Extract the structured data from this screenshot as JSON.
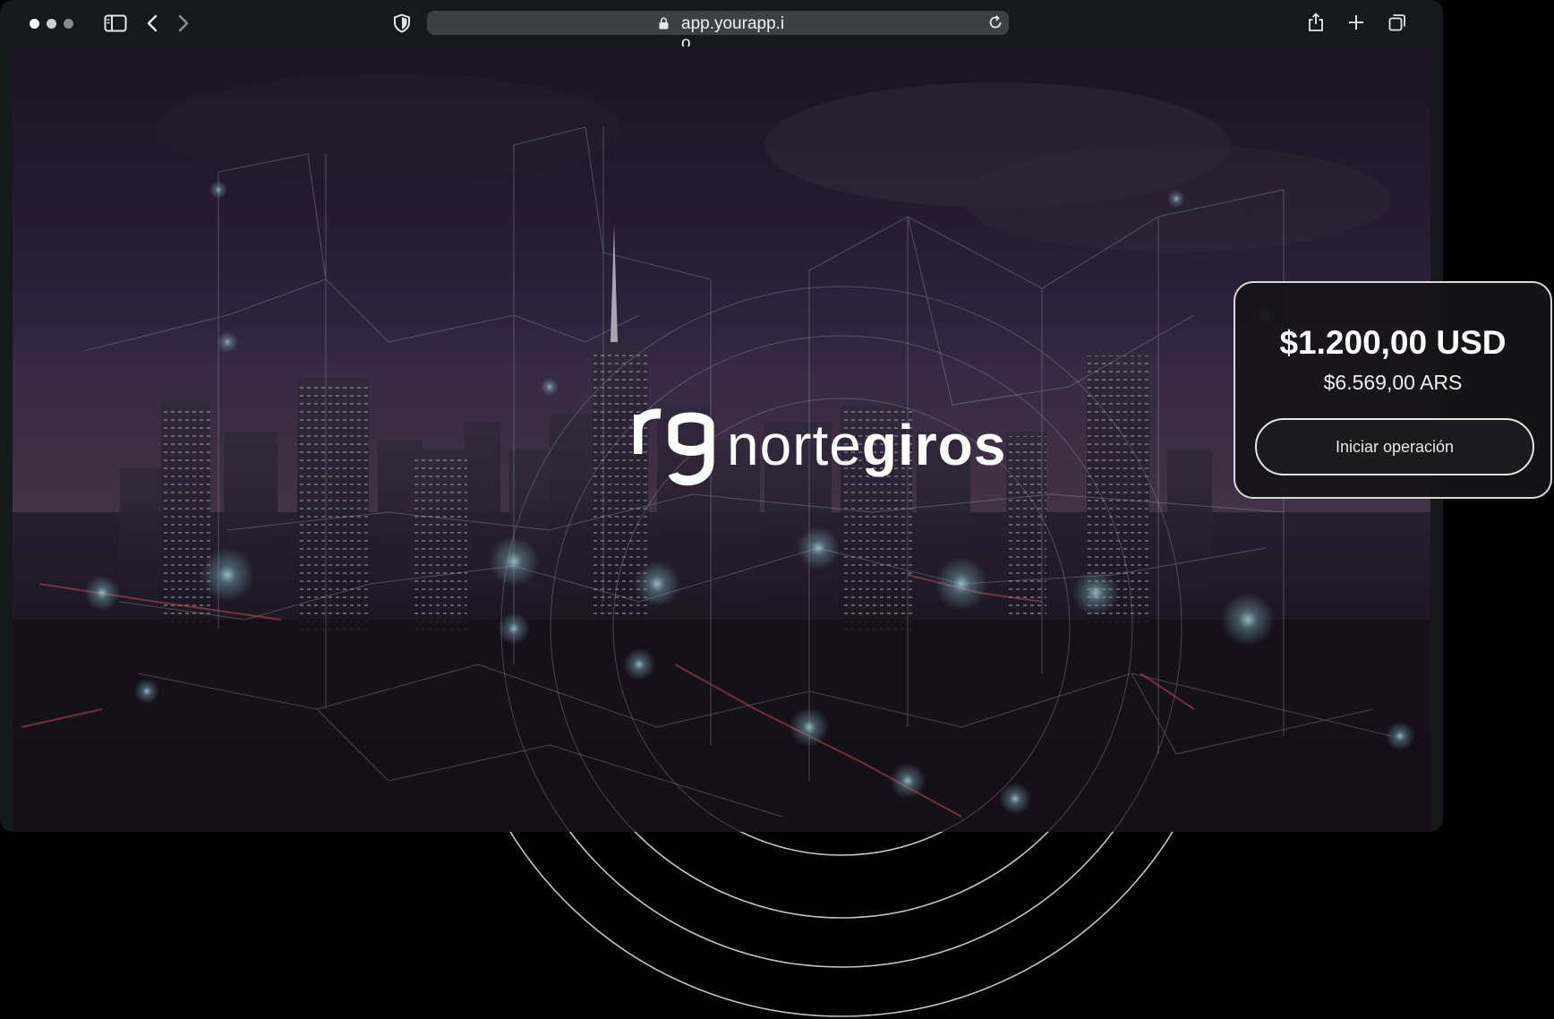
{
  "browser": {
    "url": "app.yourapp.io",
    "window_dots": [
      "#ffffff",
      "#d0d0d0",
      "#8a8a8a"
    ],
    "icons": {
      "sidebar": "sidebar-icon",
      "back": "chevron-left-icon",
      "forward": "chevron-right-icon",
      "privacy": "shield-icon",
      "lock": "lock-icon",
      "reload": "reload-icon",
      "share": "share-icon",
      "new_tab": "plus-icon",
      "tabs": "tabs-overview-icon"
    }
  },
  "hero": {
    "background": "night city skyline with network lines",
    "logo": {
      "mark": "rg",
      "word_light": "norte",
      "word_bold": "giros"
    }
  },
  "card": {
    "amount_usd": "$1.200,00 USD",
    "amount_ars": "$6.569,00 ARS",
    "button_label": "Iniciar operación"
  },
  "colors": {
    "page_background": "#000000",
    "window_chrome": "#16191c",
    "address_bar": "#3c3f43",
    "card_border": "#d9d9d9",
    "text": "#ffffff"
  }
}
